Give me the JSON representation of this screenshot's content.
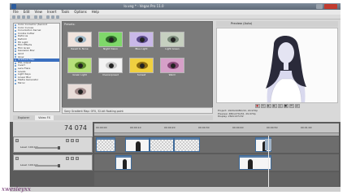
{
  "window": {
    "title": "lo.veg * - Vegas Pro 11.0"
  },
  "menu": [
    "File",
    "Edit",
    "View",
    "Insert",
    "Tools",
    "Options",
    "Help"
  ],
  "plugin_list": [
    "Color Corrector (Second",
    "Color Curves",
    "Convolution Kernel",
    "Cookie Cutter",
    "Defocus",
    "Deform",
    "Fill Light",
    "Film Effects",
    "Film Grain",
    "Gaussian Blur",
    "Glint",
    "Glow",
    "Gradient Map",
    "HSL Adjust",
    "Invert",
    "Lens Flare",
    "Levels",
    "Light Rays",
    "Linear Blur",
    "Media Generator",
    "Mirror"
  ],
  "presets": {
    "title": "Presets:",
    "items": [
      {
        "label": "Reset to None",
        "tint": "#f1e4de"
      },
      {
        "label": "Night Vision",
        "tint": "#7fd86a"
      },
      {
        "label": "Blue Light",
        "tint": "#c9b8e8"
      },
      {
        "label": "Light Green",
        "tint": "#c6d0c0"
      },
      {
        "label": "Green Light",
        "tint": "#b6e07a"
      },
      {
        "label": "Overexposed",
        "tint": "#f3f3f3"
      },
      {
        "label": "Sunset",
        "tint": "#f0d040"
      },
      {
        "label": "Warm",
        "tint": "#d6a0c8"
      },
      {
        "label": "",
        "tint": "#e8dcd8"
      }
    ]
  },
  "description": "Sony Gradient Map: OFX, 32-bit floating point",
  "tabs": [
    "Explorer",
    "Video FX"
  ],
  "active_tab": "Video FX",
  "preview": {
    "label": "Preview (Auto)"
  },
  "preview_info": [
    "Project: 1920x1080x32, 29.970p",
    "Preview: 480x270x32, 29.970p",
    "Display: 262x147x32"
  ],
  "timeline": {
    "timecode": "74 074",
    "ruler_labels": [
      "00:00:00",
      "00:00:10",
      "00:00:20",
      "00:00:30",
      "00:00:40",
      "00:00:50",
      "00:01:00"
    ],
    "tracks": [
      {
        "level": "Level: 100.0 %"
      },
      {
        "level": "Level: 100.0 %"
      }
    ]
  },
  "watermark": "xwesleyxx",
  "colors": {
    "selection": "#3a6fc0",
    "clip_border": "#3d6a9a",
    "watermark": "#6b2f6b"
  }
}
